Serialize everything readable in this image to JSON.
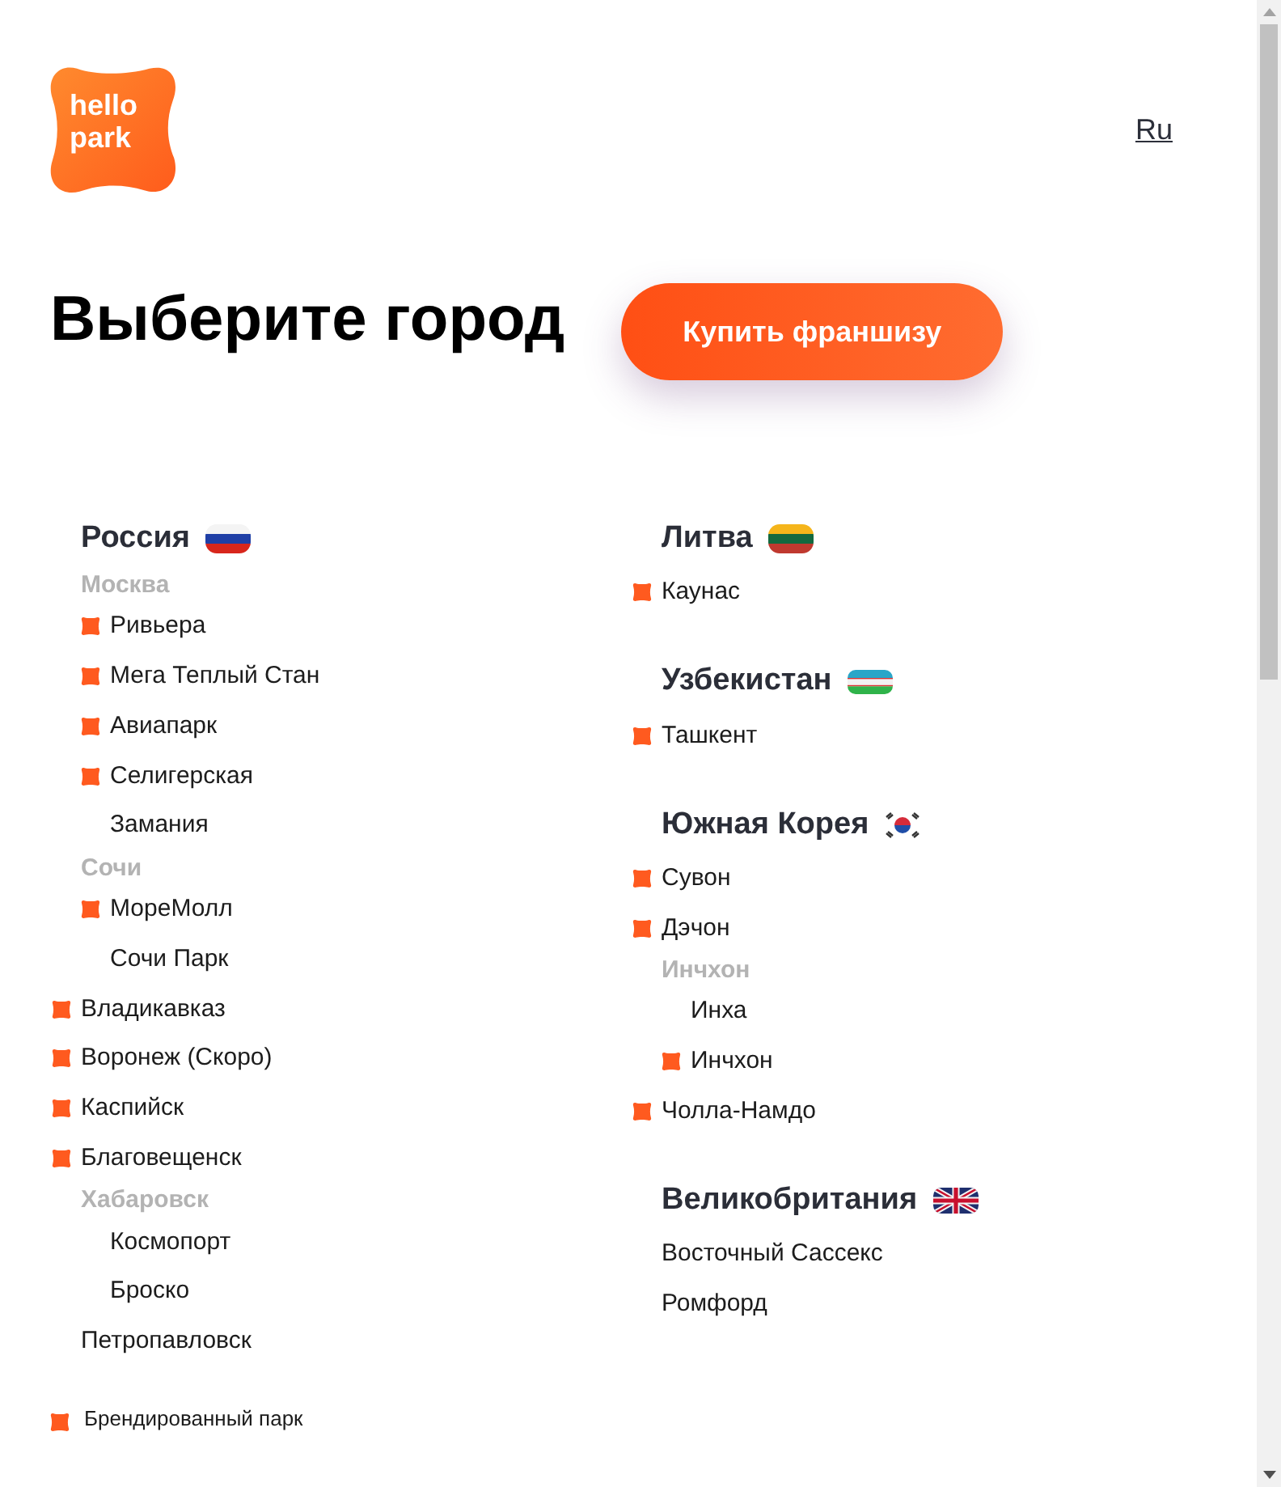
{
  "logo": {
    "lines": [
      "hello",
      "park"
    ]
  },
  "language": "Ru",
  "title": "Выберите город",
  "franchise_button": "Купить франшизу",
  "columns": [
    {
      "countries": [
        {
          "name": "Россия",
          "kind": "ru",
          "items": [
            {
              "kind": "region",
              "name": "Москва",
              "children": [
                {
                  "kind": "park",
                  "name": "Ривьера",
                  "branded": true
                },
                {
                  "kind": "park",
                  "name": "Мега Теплый Стан",
                  "branded": true
                },
                {
                  "kind": "park",
                  "name": "Авиапарк",
                  "branded": true
                },
                {
                  "kind": "park",
                  "name": "Селигерская",
                  "branded": true
                },
                {
                  "kind": "park",
                  "name": "Замания",
                  "branded": false
                }
              ]
            },
            {
              "kind": "region",
              "name": "Сочи",
              "children": [
                {
                  "kind": "park",
                  "name": "МореМолл",
                  "branded": true
                },
                {
                  "kind": "park",
                  "name": "Сочи Парк",
                  "branded": false
                }
              ]
            },
            {
              "kind": "park",
              "name": "Владикавказ",
              "branded": true
            },
            {
              "kind": "park",
              "name": "Воронеж (Скоро)",
              "branded": true
            },
            {
              "kind": "park",
              "name": "Каспийск",
              "branded": true
            },
            {
              "kind": "park",
              "name": "Благовещенск",
              "branded": true
            },
            {
              "kind": "region",
              "name": "Хабаровск",
              "children": [
                {
                  "kind": "park",
                  "name": "Космопорт",
                  "branded": false
                },
                {
                  "kind": "park",
                  "name": "Броско",
                  "branded": false
                }
              ]
            },
            {
              "kind": "park",
              "name": "Петропавловск",
              "branded": false
            }
          ]
        }
      ]
    },
    {
      "countries": [
        {
          "name": "Литва",
          "kind": "lt",
          "items": [
            {
              "kind": "park",
              "name": "Каунас",
              "branded": true
            }
          ]
        },
        {
          "name": "Узбекистан",
          "kind": "uz",
          "items": [
            {
              "kind": "park",
              "name": "Ташкент",
              "branded": true
            }
          ]
        },
        {
          "name": "Южная Корея",
          "kind": "kr",
          "items": [
            {
              "kind": "park",
              "name": "Сувон",
              "branded": true
            },
            {
              "kind": "park",
              "name": "Дэчон",
              "branded": true
            },
            {
              "kind": "region",
              "name": "Инчхон",
              "children": [
                {
                  "kind": "park",
                  "name": "Инха",
                  "branded": false
                },
                {
                  "kind": "park",
                  "name": "Инчхон",
                  "branded": true
                }
              ]
            },
            {
              "kind": "park",
              "name": "Чолла-Намдо",
              "branded": true
            }
          ]
        },
        {
          "name": "Великобритания",
          "kind": "gb",
          "items": [
            {
              "kind": "park",
              "name": "Восточный Сассекс",
              "branded": false
            },
            {
              "kind": "park",
              "name": "Ромфорд",
              "branded": false
            }
          ]
        }
      ]
    }
  ],
  "legend": {
    "label": "Брендированный парк"
  }
}
